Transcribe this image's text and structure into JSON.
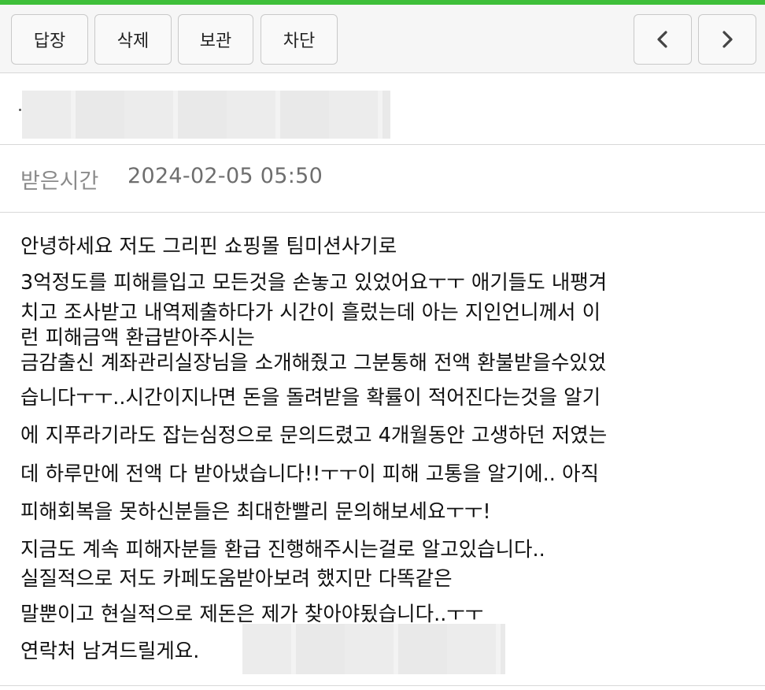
{
  "toolbar": {
    "reply_label": "답장",
    "delete_label": "삭제",
    "archive_label": "보관",
    "block_label": "차단",
    "prev_icon": "chevron-left-icon",
    "next_icon": "chevron-right-icon"
  },
  "meta": {
    "received_label": "받은시간",
    "received_value": "2024-02-05 05:50"
  },
  "message": {
    "lines": [
      "안녕하세요 저도 그리핀 쇼핑몰 팀미션사기로",
      "3억정도를 피해를입고 모든것을 손놓고 있었어요ㅜㅜ 애기들도 내팽겨",
      "치고 조사받고 내역제출하다가 시간이 흘렀는데 아는 지인언니께서 이",
      "런 피해금액 환급받아주시는",
      "금감출신 계좌관리실장님을 소개해줬고 그분통해 전액 환불받을수있었",
      "습니다ㅜㅜ..시간이지나면 돈을 돌려받을 확률이 적어진다는것을 알기",
      "에 지푸라기라도 잡는심정으로 문의드렸고 4개월동안 고생하던 저였는",
      "데 하루만에 전액 다 받아냈습니다!!ㅜㅜ이 피해 고통을 알기에.. 아직",
      "피해회복을 못하신분들은 최대한빨리 문의해보세요ㅜㅜ!",
      "지금도 계속 피해자분들 환급 진행해주시는걸로 알고있습니다..",
      "실질적으로 저도 카페도움받아보려 했지만 다똑같은",
      "말뿐이고 현실적으로 제돈은 제가 찾아야됬습니다..ㅜㅜ",
      "연락처 남겨드릴게요."
    ]
  },
  "colors": {
    "accent_strip": "#3fbf3a",
    "toolbar_bg": "#f6f6f6",
    "divider": "#d8d8d8",
    "meta_text": "#8a8a8a"
  }
}
